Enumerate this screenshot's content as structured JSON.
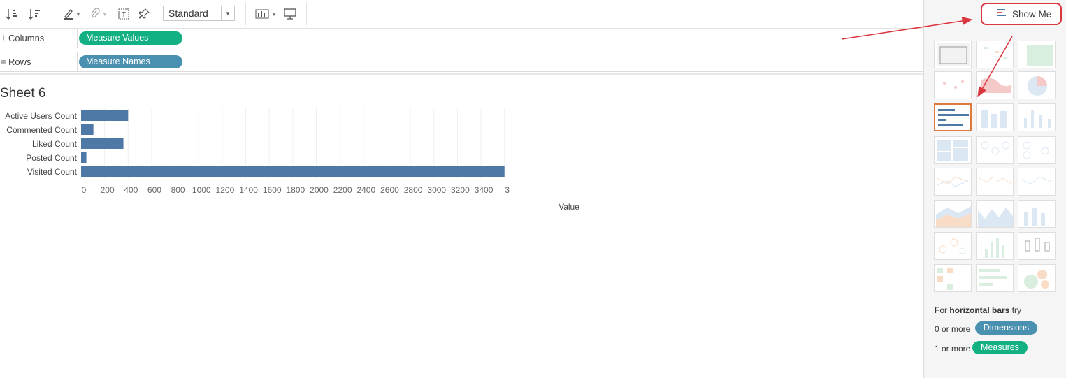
{
  "toolbar": {
    "fit_value": "Standard"
  },
  "shelves": {
    "columns_label": "Columns",
    "columns_pill": "Measure Values",
    "rows_label": "Rows",
    "rows_pill": "Measure Names"
  },
  "sheet": {
    "title": "Sheet 6"
  },
  "chart_data": {
    "type": "bar",
    "orientation": "horizontal",
    "categories": [
      "Active Users Count",
      "Commented Count",
      "Liked Count",
      "Posted Count",
      "Visited Count"
    ],
    "values": [
      400,
      105,
      360,
      45,
      3600
    ],
    "xlabel": "Value",
    "x_ticks": [
      "0",
      "200",
      "400",
      "600",
      "800",
      "1000",
      "1200",
      "1400",
      "1600",
      "1800",
      "2000",
      "2200",
      "2400",
      "2600",
      "2800",
      "3000",
      "3200",
      "3400",
      "3"
    ],
    "xlim": [
      0,
      3600
    ],
    "grid": true,
    "bar_color": "#4e79a7"
  },
  "show_me": {
    "button_label": "Show Me",
    "selected_chart": "horizontal-bars",
    "hint_prefix": "For ",
    "hint_bold": "horizontal bars",
    "hint_suffix": " try",
    "dim_prefix": "0 or more",
    "dim_pill": "Dimensions",
    "meas_prefix": "1 or more",
    "meas_pill": "Measures"
  },
  "colors": {
    "dimension_pill": "#4a90b0",
    "measure_pill": "#13b083",
    "annotation_arrow": "#d9363e"
  }
}
